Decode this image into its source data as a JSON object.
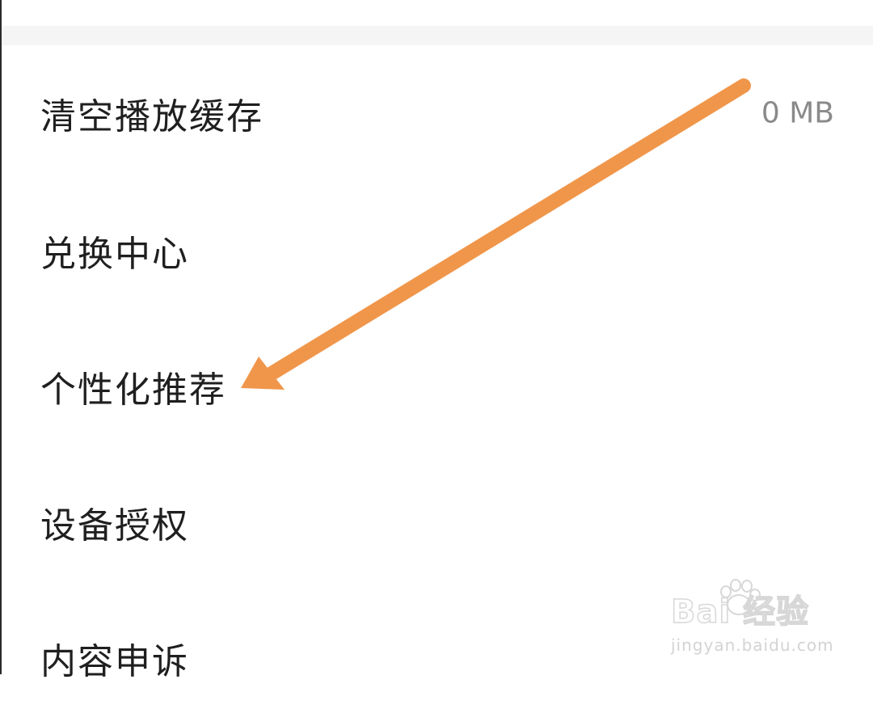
{
  "settings": {
    "items": [
      {
        "label": "清空播放缓存",
        "value": "0 MB"
      },
      {
        "label": "兑换中心"
      },
      {
        "label": "个性化推荐"
      },
      {
        "label": "设备授权"
      },
      {
        "label": "内容申诉"
      }
    ]
  },
  "annotation": {
    "color": "#F0964A",
    "icon": "arrow-annotation-icon"
  },
  "watermark": {
    "logo_text": "Bai 经验",
    "url_text": "jingyan.baidu.com"
  }
}
